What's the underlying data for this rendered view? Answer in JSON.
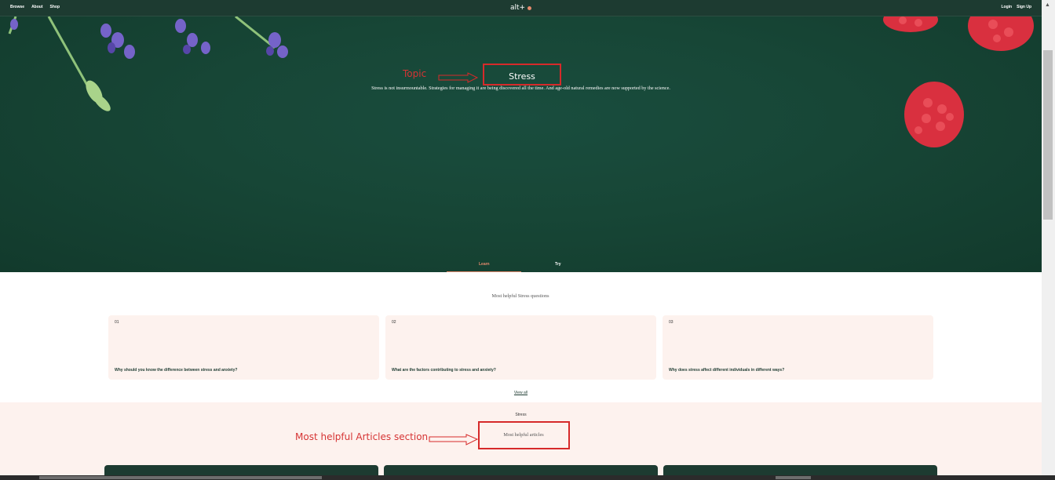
{
  "nav": {
    "left_links": [
      "Browse",
      "About",
      "Shop"
    ],
    "brand": "alt+",
    "right_links": [
      "Login",
      "Sign Up"
    ]
  },
  "hero": {
    "title": "Stress",
    "description": "Stress is not insurmountable. Strategies for managing it are being discovered all the time. And age-old natural remedies are now supported by the science.",
    "tabs": [
      "Learn",
      "Try"
    ],
    "active_tab": "Learn"
  },
  "questions": {
    "heading": "Most helpful Stress questions",
    "cards": [
      {
        "number": "01",
        "text": "Why should you know the difference between stress and anxiety?"
      },
      {
        "number": "02",
        "text": "What are the factors contributing to stress and anxiety?"
      },
      {
        "number": "03",
        "text": "Why does stress affect different individuals in different ways?"
      }
    ],
    "view_all": "View all"
  },
  "articles": {
    "kicker": "Stress",
    "heading": "Most helpful articles"
  },
  "annotations": {
    "topic_label": "Topic",
    "articles_label": "Most helpful Articles section"
  },
  "colors": {
    "brand_green": "#1d3b31",
    "accent": "#e58a6d",
    "card_bg": "#fdf2ee",
    "annotation_red": "#d62a2a"
  }
}
